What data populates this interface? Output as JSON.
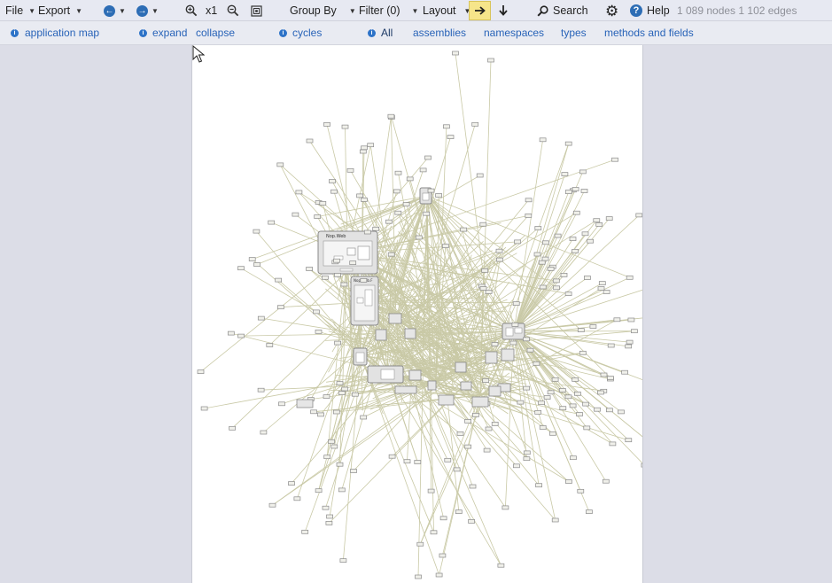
{
  "toolbar": {
    "file_label": "File",
    "export_label": "Export",
    "zoom_label": "x1",
    "group_by_label": "Group By",
    "filter_label": "Filter (0)",
    "layout_label": "Layout",
    "search_label": "Search",
    "help_label": "Help",
    "stats_text": "1 089 nodes 1 102 edges",
    "icons": [
      "back-arrow-icon",
      "forward-arrow-icon",
      "zoom-in-icon",
      "zoom-out-icon",
      "fit-to-screen-icon",
      "arrow-right-icon",
      "arrow-down-icon",
      "search-icon",
      "gear-icon",
      "help-icon"
    ]
  },
  "links": {
    "application_map": "application map",
    "expand": "expand",
    "collapse": "collapse",
    "cycles": "cycles",
    "all": "All",
    "assemblies": "assemblies",
    "namespaces": "namespaces",
    "types": "types",
    "methods_and_fields": "methods and fields"
  },
  "graph": {
    "group_titles": [
      "Nop.Web",
      "Nop.Web.F"
    ],
    "edge_color": "#c9c9a6",
    "node_border_color": "#8a8a8a",
    "group_fill": "#e2e2e2"
  },
  "colors": {
    "toolbar_bg": "#e7e9f2",
    "link_color": "#2863b8",
    "active_toggle": "#f6e58a",
    "canvas_bg": "#ffffff",
    "app_bg": "#dcdde7"
  }
}
